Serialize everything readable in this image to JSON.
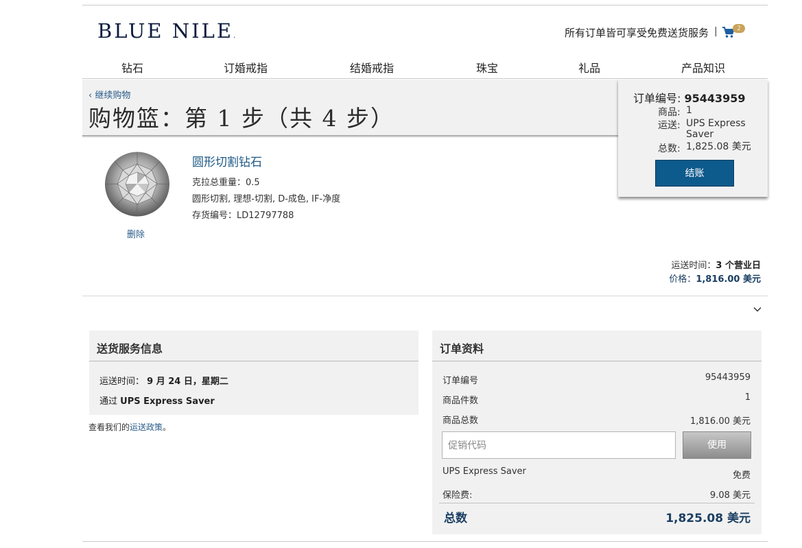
{
  "header": {
    "logo": "BLUE NILE",
    "logo_mark": ".",
    "promo_text": "所有订单皆可享受免费送货服务",
    "separator": "|",
    "cart_icon": "shopping-cart-icon",
    "cart_count": "2"
  },
  "nav": {
    "items": [
      "钻石",
      "订婚戒指",
      "结婚戒指",
      "珠宝",
      "礼品",
      "产品知识"
    ]
  },
  "page": {
    "back_link": "‹ 继续购物",
    "title": "购物篮：第 1 步（共 4 步）"
  },
  "summary": {
    "order_label": "订单编号:",
    "order_number": "95443959",
    "items_label": "商品:",
    "items_value": "1",
    "shipping_label": "运送:",
    "shipping_value": "UPS Express Saver",
    "total_label": "总数:",
    "total_value": "1,825.08 美元",
    "checkout_button": "结账"
  },
  "item": {
    "image_icon": "round-diamond-icon",
    "title": "圆形切割钻石",
    "carat": "克拉总重量：0.5",
    "specs": "圆形切割, 理想-切割, D-成色, IF-净度",
    "sku": "存货编号：LD12797788",
    "delete_link": "删除",
    "ship_time_label": "运送时间：",
    "ship_time_value": "3 个营业日",
    "price_label": "价格：",
    "price_value": "1,816.00 美元",
    "expand_icon": "chevron-down-icon"
  },
  "shipping_info": {
    "heading": "送货服务信息",
    "delivery_label": "运送时间：",
    "delivery_value": "9 月 24 日，星期二",
    "via_label": "通过",
    "via_value": "UPS Express Saver",
    "policy_prefix": "查看我们的",
    "policy_link": "运送政策",
    "policy_suffix": "。"
  },
  "order_details": {
    "heading": "订单资料",
    "rows": [
      {
        "label": "订单编号",
        "value": "95443959"
      },
      {
        "label": "商品件数",
        "value": "1"
      },
      {
        "label": "商品总数",
        "value": "1,816.00 美元"
      }
    ],
    "promo_placeholder": "促销代码",
    "apply_button": "使用",
    "shipping_method": "UPS Express Saver",
    "shipping_cost": "免费",
    "insurance_label": "保险费:",
    "insurance_value": "9.08 美元",
    "total_label": "总数",
    "total_value": "1,825.08 美元"
  },
  "colors": {
    "brand_navy": "#0d1b3e",
    "link_blue": "#2a5d8a",
    "checkout_blue": "#0d5a8c",
    "panel_grey": "#f1f1f1",
    "badge_gold": "#c8a35b"
  }
}
